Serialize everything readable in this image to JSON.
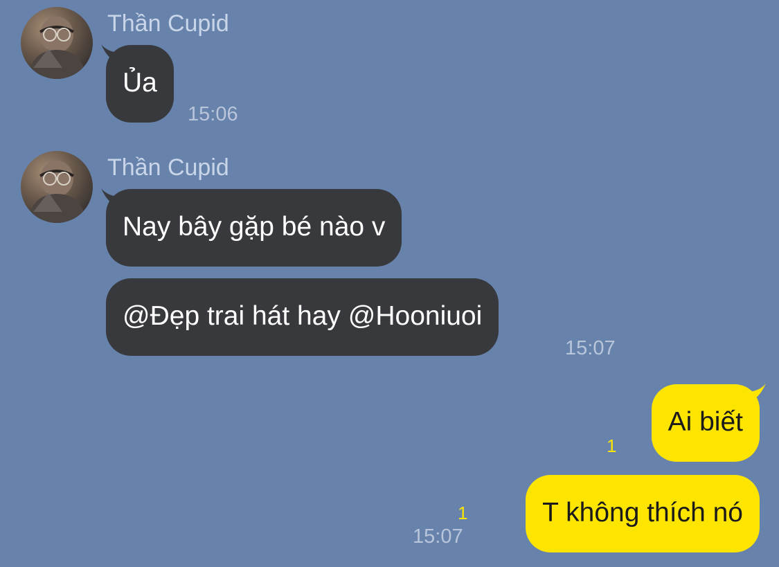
{
  "chat": {
    "colors": {
      "background": "#6783ab",
      "incoming_bubble": "#38393c",
      "outgoing_bubble": "#fee500",
      "unread_count": "#fee500"
    },
    "groups": [
      {
        "sender": "Thần Cupid",
        "messages": [
          "Ủa"
        ],
        "time": "15:06"
      },
      {
        "sender": "Thần Cupid",
        "messages": [
          "Nay bây gặp bé nào v",
          "@Đẹp trai hát hay @Hooniuoi"
        ],
        "time": "15:07"
      }
    ],
    "outgoing": [
      {
        "text": "Ai biết",
        "unread": "1"
      },
      {
        "text": "T không thích nó",
        "unread": "1",
        "time": "15:07"
      }
    ]
  }
}
